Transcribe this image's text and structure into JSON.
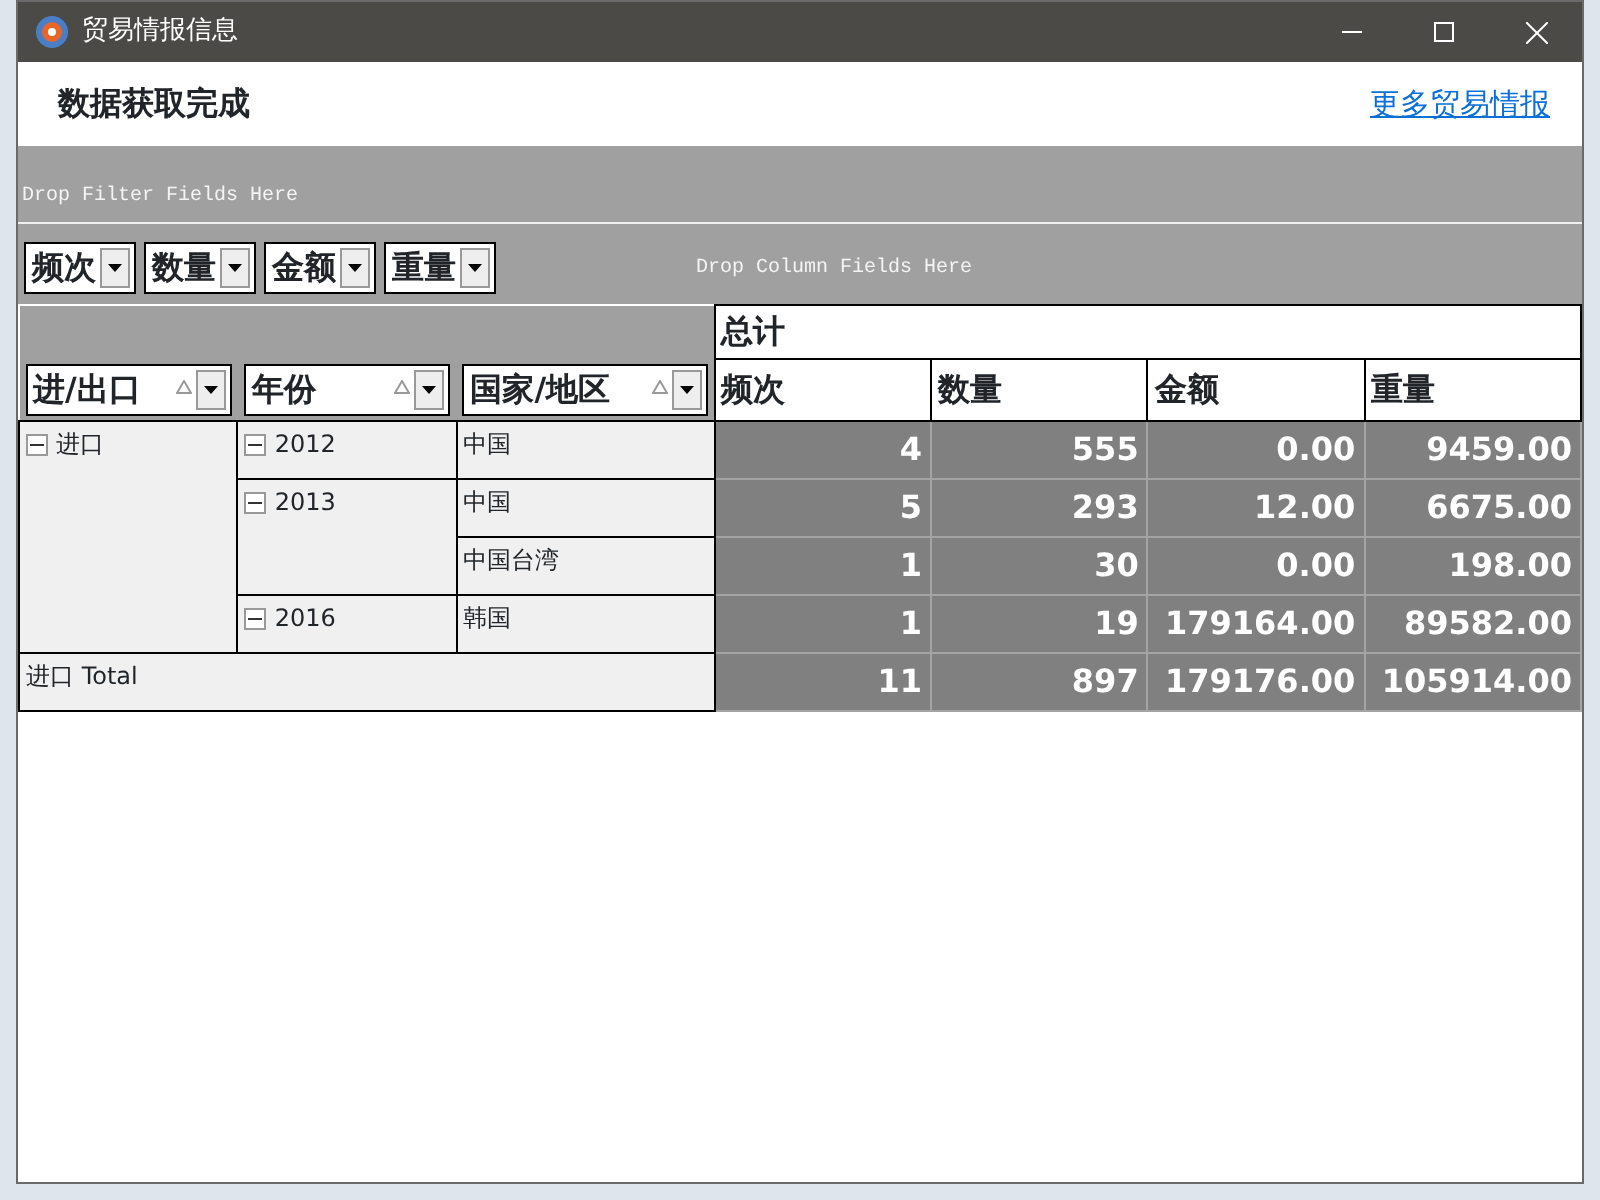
{
  "window": {
    "title": "贸易情报信息"
  },
  "header": {
    "status": "数据获取完成",
    "link": "更多贸易情报"
  },
  "pivot": {
    "filter_hint": "Drop Filter Fields Here",
    "column_hint": "Drop Column Fields Here",
    "data_fields": [
      "频次",
      "数量",
      "金额",
      "重量"
    ],
    "row_fields": [
      "进/出口",
      "年份",
      "国家/地区"
    ],
    "grand_header": "总计",
    "column_headers": [
      "频次",
      "数量",
      "金额",
      "重量"
    ],
    "rows": [
      {
        "label": "进口",
        "expanded": true,
        "children": [
          {
            "label": "2012",
            "expanded": true,
            "children": [
              {
                "label": "中国",
                "values": [
                  "4",
                  "555",
                  "0.00",
                  "9459.00"
                ]
              }
            ]
          },
          {
            "label": "2013",
            "expanded": true,
            "children": [
              {
                "label": "中国",
                "values": [
                  "5",
                  "293",
                  "12.00",
                  "6675.00"
                ]
              },
              {
                "label": "中国台湾",
                "values": [
                  "1",
                  "30",
                  "0.00",
                  "198.00"
                ]
              }
            ]
          },
          {
            "label": "2016",
            "expanded": true,
            "children": [
              {
                "label": "韩国",
                "values": [
                  "1",
                  "19",
                  "179164.00",
                  "89582.00"
                ]
              }
            ]
          }
        ]
      }
    ],
    "total": {
      "label": "进口 Total",
      "values": [
        "11",
        "897",
        "179176.00",
        "105914.00"
      ]
    }
  }
}
